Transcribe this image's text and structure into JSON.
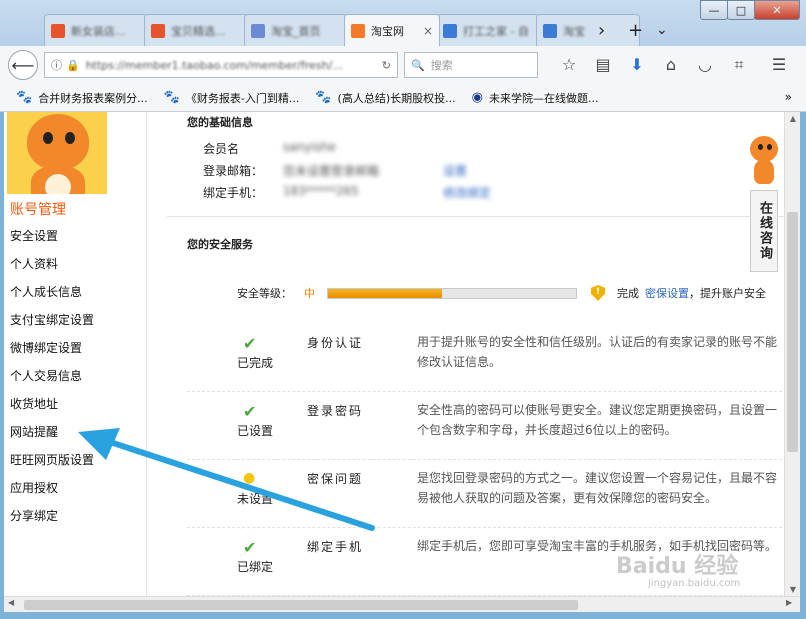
{
  "browser": {
    "tabs": [
      {
        "label": "新女装店...",
        "color": "#e5542c"
      },
      {
        "label": "宝贝精选...",
        "color": "#e5542c"
      },
      {
        "label": "淘宝_首页",
        "color": "#6b8cd5"
      },
      {
        "label": "淘宝网",
        "color": "#f47a2a",
        "active": true
      },
      {
        "label": "打工之家 - 自",
        "color": "#3a7bd5"
      },
      {
        "label": "淘宝",
        "color": "#3a7bd5"
      }
    ],
    "tab_close": "×",
    "tab_controls": {
      "next": "›",
      "new": "+",
      "list": "⌄"
    },
    "window_buttons": {
      "minimize": "—",
      "maximize": "□",
      "close": "✕"
    },
    "url": "https://member1.taobao.com/member/fresh/...",
    "search_placeholder": "搜索",
    "bookmarks": [
      {
        "label": "合并财务报表案例分..."
      },
      {
        "label": "《财务报表-入门到精..."
      },
      {
        "label": "(高人总结)长期股权投..."
      },
      {
        "label": "未来学院—在线做题..."
      }
    ],
    "bookmarks_more": "»"
  },
  "sidebar": {
    "title": "账号管理",
    "items": [
      "安全设置",
      "个人资料",
      "个人成长信息",
      "支付宝绑定设置",
      "微博绑定设置",
      "个人交易信息",
      "收货地址",
      "网站提醒",
      "旺旺网页版设置",
      "应用授权",
      "分享绑定"
    ]
  },
  "basic_info": {
    "title": "您的基础信息",
    "rows": [
      {
        "label": "会员名",
        "value": "sanyishe",
        "link": ""
      },
      {
        "label": "登录邮箱：",
        "value": "您未设置登录邮箱",
        "link": "设置"
      },
      {
        "label": "绑定手机：",
        "value": "183*****265",
        "link": "修改绑定"
      }
    ]
  },
  "security": {
    "title": "您的安全服务",
    "level_label": "安全等级：",
    "level_value": "中",
    "level_fraction": 0.46,
    "complete_text": "完成",
    "complete_link": "密保设置",
    "complete_suffix": "，提升账户安全",
    "services": [
      {
        "icon": "check",
        "status": "已完成",
        "name": "身份认证",
        "desc": "用于提升账号的安全性和信任级别。认证后的有卖家记录的账号不能修改认证信息。"
      },
      {
        "icon": "check",
        "status": "已设置",
        "name": "登录密码",
        "desc": "安全性高的密码可以使账号更安全。建议您定期更换密码，且设置一个包含数字和字母，并长度超过6位以上的密码。"
      },
      {
        "icon": "bulb",
        "status": "未设置",
        "name": "密保问题",
        "desc": "是您找回登录密码的方式之一。建议您设置一个容易记住，且最不容易被他人获取的问题及答案，更有效保障您的密码安全。"
      },
      {
        "icon": "check",
        "status": "已绑定",
        "name": "绑定手机",
        "desc": "绑定手机后，您即可享受淘宝丰富的手机服务，如手机找回密码等。"
      }
    ]
  },
  "consult": {
    "label": "在线咨询"
  },
  "watermark": {
    "text": "Baidu 经验",
    "sub": "jingyan.baidu.com"
  }
}
